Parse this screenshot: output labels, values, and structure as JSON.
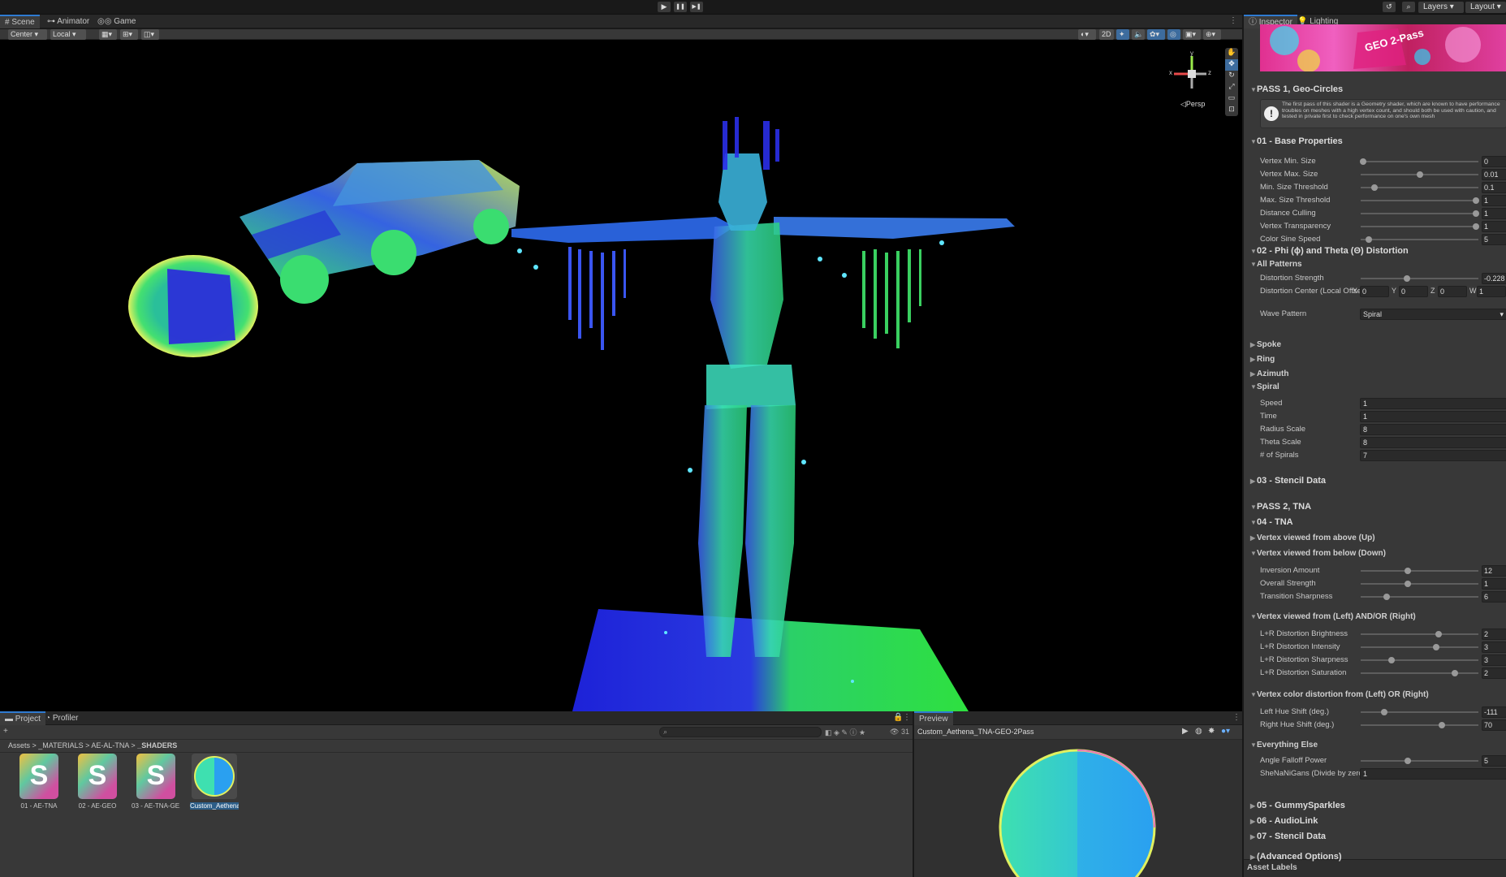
{
  "topbar": {
    "play": "▶",
    "pause": "❚❚",
    "step": "▶❚",
    "history": "↺",
    "search": "⌕",
    "layers": "Layers",
    "layout": "Layout"
  },
  "scene_panel": {
    "tabs": [
      {
        "label": "Scene",
        "icon": "#"
      },
      {
        "label": "Animator",
        "icon": "⊶"
      },
      {
        "label": "Game",
        "icon": "◎◎"
      }
    ],
    "toolbar": {
      "pivot": "Center",
      "space": "Local",
      "mode_2d": "2D"
    },
    "gizmo": {
      "projection": "Persp",
      "x": "x",
      "y": "y",
      "z": "z"
    }
  },
  "inspector": {
    "tabs": [
      {
        "label": "Inspector",
        "icon": "ⓘ"
      },
      {
        "label": "Lighting",
        "icon": "💡"
      }
    ],
    "banner_text": "GEO 2-Pass",
    "pass1": "PASS 1, Geo-Circles",
    "warning": "The first pass of this shader is a Geometry shader, which are known to have performance troubles on meshes with a high vertex count, and should both be used with caution, and tested in private first to check performance on one's own mesh",
    "base": {
      "title": "01 - Base Properties",
      "rows": [
        {
          "label": "Vertex Min. Size",
          "value": "0",
          "pos": 0.02
        },
        {
          "label": "Vertex Max. Size",
          "value": "0.01",
          "pos": 0.5
        },
        {
          "label": "Min. Size Threshold",
          "value": "0.1",
          "pos": 0.12
        },
        {
          "label": "Max. Size Threshold",
          "value": "1",
          "pos": 0.98
        },
        {
          "label": "Distance Culling",
          "value": "1",
          "pos": 0.98
        },
        {
          "label": "Vertex Transparency",
          "value": "1",
          "pos": 0.98
        },
        {
          "label": "Color Sine Speed",
          "value": "5",
          "pos": 0.07
        }
      ]
    },
    "distortion": {
      "title": "02 - Phi (ϕ) and Theta (Θ) Distortion",
      "all_patterns": "All Patterns",
      "strength_label": "Distortion Strength",
      "strength_value": "-0.228",
      "strength_pos": 0.39,
      "center_label": "Distortion Center (Local Offset)",
      "center": [
        {
          "axis": "X",
          "value": "0"
        },
        {
          "axis": "Y",
          "value": "0"
        },
        {
          "axis": "Z",
          "value": "0"
        },
        {
          "axis": "W",
          "value": "1"
        }
      ],
      "wave_label": "Wave Pattern",
      "wave_value": "Spiral",
      "patterns": [
        "Spoke",
        "Ring",
        "Azimuth"
      ],
      "spiral": "Spiral",
      "spiral_rows": [
        {
          "label": "Speed",
          "value": "1"
        },
        {
          "label": "Time",
          "value": "1"
        },
        {
          "label": "Radius Scale",
          "value": "8"
        },
        {
          "label": "Theta Scale",
          "value": "8"
        },
        {
          "label": "# of Spirals",
          "value": "7"
        }
      ]
    },
    "stencil1": "03 - Stencil Data",
    "pass2": "PASS 2, TNA",
    "tna": {
      "title": "04 - TNA",
      "up": "Vertex viewed from above (Up)",
      "down": "Vertex viewed from below (Down)",
      "down_rows": [
        {
          "label": "Inversion Amount",
          "value": "12",
          "pos": 0.4
        },
        {
          "label": "Overall Strength",
          "value": "1",
          "pos": 0.4
        },
        {
          "label": "Transition Sharpness",
          "value": "6",
          "pos": 0.22
        }
      ],
      "lr": "Vertex viewed from (Left) AND/OR (Right)",
      "lr_rows": [
        {
          "label": "L+R Distortion Brightness",
          "value": "2",
          "pos": 0.66
        },
        {
          "label": "L+R Distortion Intensity",
          "value": "3",
          "pos": 0.64
        },
        {
          "label": "L+R Distortion Sharpness",
          "value": "3",
          "pos": 0.26
        },
        {
          "label": "L+R Distortion Saturation",
          "value": "2",
          "pos": 0.8
        }
      ],
      "color": "Vertex color distortion from (Left) OR (Right)",
      "color_rows": [
        {
          "label": "Left Hue Shift (deg.)",
          "value": "-111",
          "pos": 0.2
        },
        {
          "label": "Right Hue Shift (deg.)",
          "value": "70",
          "pos": 0.69
        }
      ],
      "else": "Everything Else",
      "angle_label": "Angle Falloff Power",
      "angle_value": "5",
      "angle_pos": 0.4,
      "shenan_label": "SheNaNiGans (Divide by zero)",
      "shenan_value": "1"
    },
    "tail": [
      "05 - GummySparkles",
      "06 - AudioLink",
      "07 - Stencil Data",
      "(Advanced Options)"
    ],
    "asset_labels": "Asset Labels"
  },
  "project_panel": {
    "tabs": [
      {
        "label": "Project",
        "icon": "▬"
      },
      {
        "label": "Profiler",
        "icon": "◔"
      }
    ],
    "breadcrumb": [
      "Assets",
      "_MATERIALS",
      "AE-AL-TNA",
      "_SHADERS"
    ],
    "count": "31",
    "assets": [
      {
        "name": "01 - AE-TNA",
        "glyph": "S"
      },
      {
        "name": "02 - AE-GEO",
        "glyph": "S"
      },
      {
        "name": "03 - AE-TNA-GE...",
        "glyph": "S"
      },
      {
        "name": "Custom_Aethena...",
        "glyph": ""
      }
    ]
  },
  "preview_panel": {
    "tab": "Preview",
    "title": "Custom_Aethena_TNA-GEO-2Pass"
  }
}
